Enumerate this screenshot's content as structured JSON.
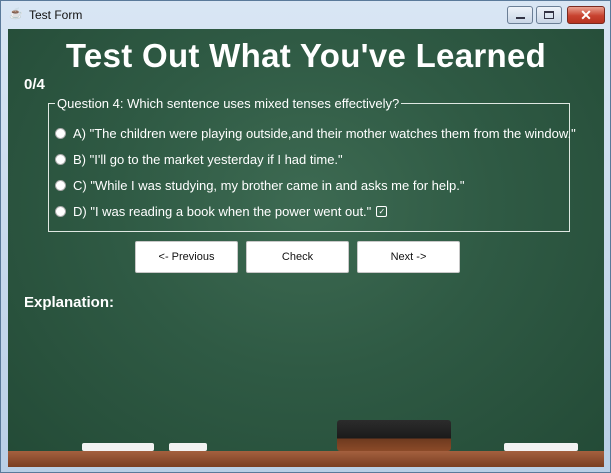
{
  "window": {
    "title": "Test Form",
    "icon": "app-icon",
    "controls": {
      "minimize": "minimize",
      "maximize": "maximize",
      "close": "✕"
    }
  },
  "board": {
    "heading": "Test Out What You've Learned",
    "score": "0/4"
  },
  "question": {
    "legend": "Question 4: Which sentence uses mixed tenses effectively?",
    "options": [
      {
        "label": "A) \"The children were playing outside,and their mother watches them from the window.\""
      },
      {
        "label": "B) \"I'll go to the market yesterday if I had time.\""
      },
      {
        "label": "C) \"While I was studying, my brother came in and asks me for help.\""
      },
      {
        "label": "D) \"I was reading a book when the power went out.\"",
        "icon": "checkbox-icon"
      }
    ]
  },
  "buttons": {
    "previous": "<- Previous",
    "check": "Check",
    "next": "Next ->"
  },
  "explanation": {
    "label": "Explanation:"
  }
}
